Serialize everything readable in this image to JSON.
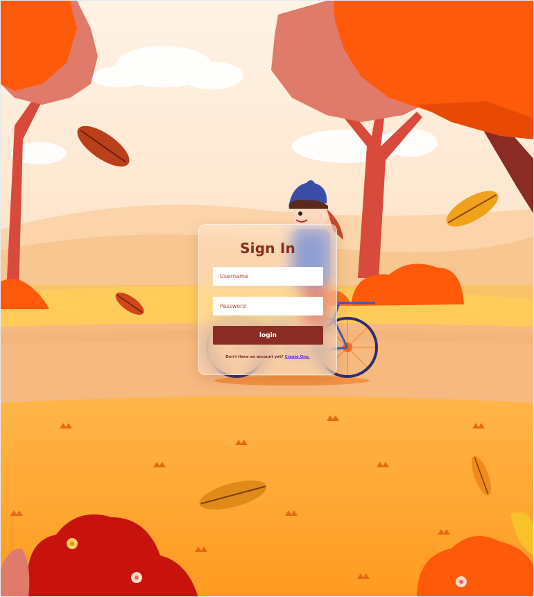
{
  "login": {
    "title": "Sign In",
    "username_placeholder": "Username",
    "password_placeholder": "Password",
    "login_label": "login",
    "signup_prompt": "Don't Have an account yet?",
    "signup_link": "Create One."
  },
  "colors": {
    "accent": "#8b2c24",
    "title": "#8a2b22",
    "link": "#5a2bd3"
  }
}
